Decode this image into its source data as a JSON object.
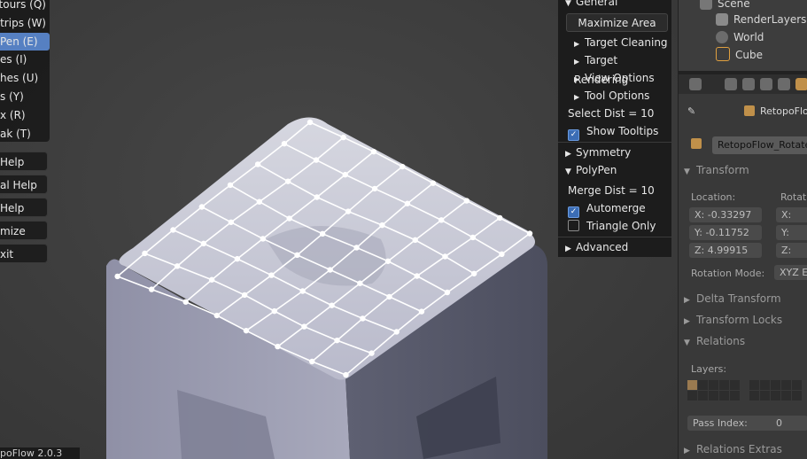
{
  "left_menu": {
    "items": [
      {
        "label": "tours (Q)",
        "active": false
      },
      {
        "label": "Strips (W)",
        "active": false
      },
      {
        "label": "Pen (E)",
        "active": true
      },
      {
        "label": "es (I)",
        "active": false
      },
      {
        "label": "hes (U)",
        "active": false
      },
      {
        "label": "s (Y)",
        "active": false
      },
      {
        "label": "x (R)",
        "active": false
      },
      {
        "label": "ak (T)",
        "active": false
      }
    ],
    "buttons": [
      "Help",
      "al Help",
      "Help",
      "mize",
      "xit"
    ],
    "version": "poFlow 2.0.3"
  },
  "rf_panel": {
    "general_header": "General",
    "maximize_label": "Maximize Area",
    "general_items": [
      "Target Cleaning",
      "Target Rendering",
      "View Options",
      "Tool Options"
    ],
    "select_dist_label": "Select Dist",
    "select_dist_value": "10",
    "show_tooltips_label": "Show Tooltips",
    "show_tooltips_checked": true,
    "symmetry_header": "Symmetry",
    "polypen_header": "PolyPen",
    "merge_dist_label": "Merge Dist",
    "merge_dist_value": "10",
    "automerge_label": "Automerge",
    "automerge_checked": true,
    "triangle_only_label": "Triangle Only",
    "triangle_only_checked": false,
    "advanced_header": "Advanced"
  },
  "outliner": {
    "scene": "Scene",
    "render_layers": "RenderLayers",
    "world": "World",
    "cube": "Cube"
  },
  "properties": {
    "breadcrumb": "RetopoFlow",
    "object_name": "RetopoFlow_Rotate",
    "transform_header": "Transform",
    "location_label": "Location:",
    "rotation_label": "Rotatio",
    "loc_x": "X: -0.33297",
    "loc_y": "Y: -0.11752",
    "loc_z": "Z: 4.99915",
    "rot_x": "X:",
    "rot_y": "Y:",
    "rot_z": "Z:",
    "rotation_mode_label": "Rotation Mode:",
    "rotation_mode_value": "XYZ E",
    "delta_transform_header": "Delta Transform",
    "transform_locks_header": "Transform Locks",
    "relations_header": "Relations",
    "layers_label": "Layers:",
    "pass_index_label": "Pass Index:",
    "pass_index_value": "0",
    "relations_extras_header": "Relations Extras"
  },
  "colors": {
    "accent": "#5680c2",
    "mesh_wire": "#ffffff",
    "object_icon": "#c0904a"
  },
  "icons": [
    "triangle-right-icon",
    "triangle-down-icon",
    "checkbox-icon",
    "pin-icon",
    "object-icon",
    "scene-icon",
    "render-layers-icon",
    "world-icon",
    "cube-icon"
  ]
}
